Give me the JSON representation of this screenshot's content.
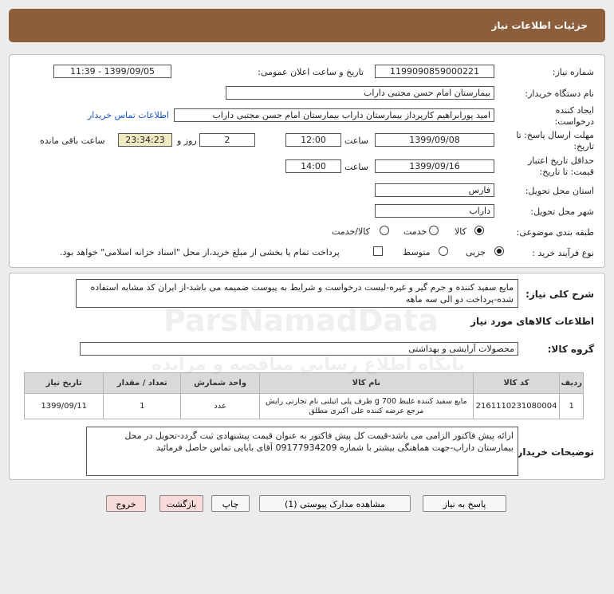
{
  "title": "جزئیات اطلاعات نیاز",
  "form": {
    "need_number_label": "شماره نیاز:",
    "need_number": "1199090859000221",
    "announce_label": "تاریخ و ساعت اعلان عمومی:",
    "announce_value": "1399/09/05 - 11:39",
    "buyer_label": "نام دستگاه خریدار:",
    "buyer_value": "بیمارستان امام حسن مجتبی داراب",
    "requester_label": "ایجاد کننده درخواست:",
    "requester_value": "امید پورابراهیم کارپرداز بیمارستان داراب بیمارستان امام حسن مجتبی داراب",
    "contact_link": "اطلاعات تماس خریدار",
    "deadline_label": "مهلت ارسال پاسخ: تا تاریخ:",
    "deadline_date": "1399/09/08",
    "time_label": "ساعت",
    "deadline_time": "12:00",
    "days_value": "2",
    "days_label": "روز و",
    "remaining_value": "23:34:23",
    "remaining_label": "ساعت باقی مانده",
    "validity_label": "حداقل تاریخ اعتبار قیمت: تا تاریخ:",
    "validity_date": "1399/09/16",
    "validity_time": "14:00",
    "province_label": "استان محل تحویل:",
    "province_value": "فارس",
    "city_label": "شهر محل تحویل:",
    "city_value": "داراب",
    "category_label": "طبقه بندی موضوعی:",
    "category_options": [
      "کالا",
      "خدمت",
      "کالا/خدمت"
    ],
    "category_selected": "کالا",
    "process_label": "نوع فرآیند خرید :",
    "process_options": [
      "جزیی",
      "متوسط"
    ],
    "process_selected": "جزیی",
    "payment_note": "پرداخت تمام یا بخشی از مبلغ خرید،از محل \"اسناد خزانه اسلامی\" خواهد بود."
  },
  "summary": {
    "label": "شرح کلی نیاز:",
    "text": "مایع سفید کننده و جرم گیر و غیره-لیست درخواست و شرایط به پیوست ضمیمه می باشد-از ایران کد مشابه استفاده شده-پرداخت دو الی سه ماهه"
  },
  "goods": {
    "section_title": "اطلاعات کالاهای مورد نیاز",
    "group_label": "گروه کالا:",
    "group_value": "محصولات آرایشی و بهداشتی",
    "headers": [
      "ردیف",
      "کد کالا",
      "نام کالا",
      "واحد شمارش",
      "تعداد / مقدار",
      "تاریخ نیاز"
    ],
    "rows": [
      {
        "row": "1",
        "code": "2161110231080004",
        "name": "مایع سفید کننده غلیظ 700 g ظرف پلی اتیلنی نام تجارتی رایش مرجع عرضه کننده علی اکبری مطلق",
        "unit": "عدد",
        "qty": "1",
        "date": "1399/09/11"
      }
    ]
  },
  "buyer_notes": {
    "label": "توضیحات خریدار:",
    "text": "ارائه پیش فاکتور الزامی می باشد-قیمت کل پیش فاکتور به عنوان قیمت پیشنهادی ثبت گردد-تحویل در محل بیمارستان داراب-جهت هماهنگی بیشتر با شماره 09177934209 آقای بابایی تماس حاصل فرمائید"
  },
  "buttons": {
    "reply": "پاسخ به نیاز",
    "docs": "مشاهده مدارک پیوستی (1)",
    "print": "چاپ",
    "back": "بازگشت",
    "exit": "خروج"
  },
  "watermark": {
    "brand": "ParsNamadData",
    "sub": "پایگاه اطلاع رسانی مناقصه و مزایده"
  }
}
